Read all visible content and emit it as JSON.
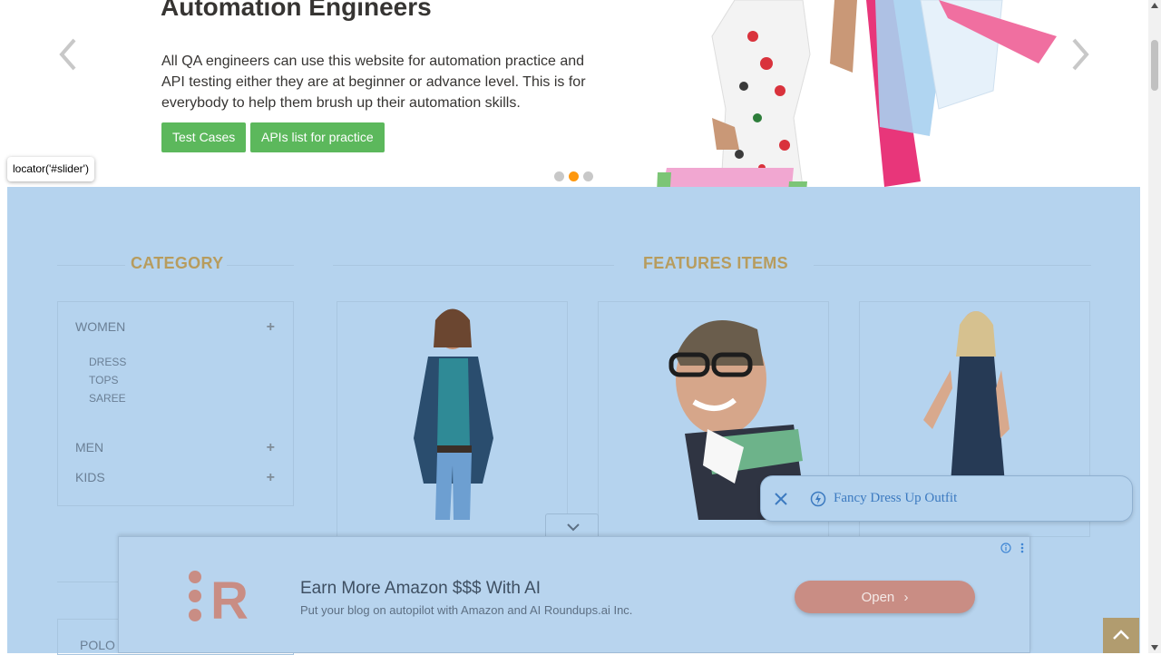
{
  "hero": {
    "title": "Automation Engineers",
    "text": "All QA engineers can use this website for automation practice and API testing either they are at beginner or advance level. This is for everybody to help them brush up their automation skills.",
    "btn_test_cases": "Test Cases",
    "btn_apis": "APIs list for practice",
    "active_dot": 2
  },
  "locator_tooltip": "locator('#slider')",
  "category": {
    "heading": "CATEGORY",
    "women": "WOMEN",
    "women_sub": [
      "DRESS",
      "TOPS",
      "SAREE"
    ],
    "men": "MEN",
    "kids": "KIDS",
    "plus": "+",
    "polo": "POLO"
  },
  "features": {
    "heading": "FEATURES ITEMS"
  },
  "ad": {
    "title": "Earn More Amazon $$$ With AI",
    "subtitle": "Put your blog on autopilot with Amazon and AI Roundups.ai Inc.",
    "open_label": "Open",
    "logo_letter": "R"
  },
  "suggestion": {
    "text": "Fancy Dress Up Outfit"
  },
  "colors": {
    "highlight": "#b5d3ee",
    "accent": "#fe980f",
    "green": "#5cb85c",
    "heading": "#b79c5e"
  }
}
